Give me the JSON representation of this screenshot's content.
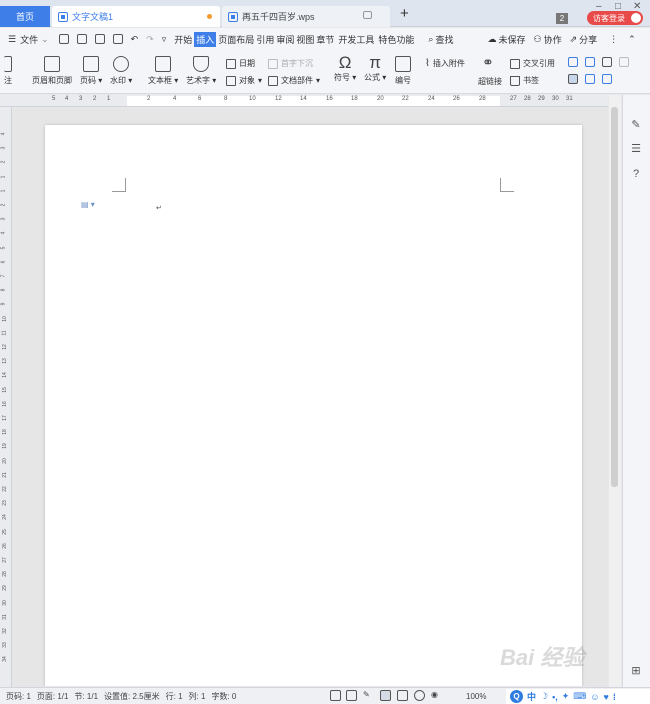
{
  "tabs": {
    "home": "首页",
    "active_doc": "文字文稿1",
    "other_doc": "再五千四百岁.wps",
    "badge": "2",
    "login": "访客登录"
  },
  "menu": {
    "file": "文件",
    "items": [
      "开始",
      "插入",
      "页面布局",
      "引用",
      "审阅",
      "视图",
      "章节",
      "开发工具",
      "特色功能"
    ],
    "active": "插入",
    "search": "查找",
    "unsaved": "未保存",
    "collab": "协作",
    "share": "分享"
  },
  "ribbon": {
    "note": "注",
    "header_footer": "页眉和页脚",
    "page_num": "页码",
    "watermark": "水印",
    "textbox": "文本框",
    "wordart": "艺术字",
    "date": "日期",
    "object": "对象",
    "dropcap": "首字下沉",
    "doc_parts": "文档部件",
    "symbol": "符号",
    "formula": "公式",
    "number": "编号",
    "attach": "插入附件",
    "hyperlink": "超链接",
    "crossref": "交叉引用",
    "bookmark": "书签"
  },
  "ruler": {
    "left": [
      "5",
      "4",
      "3",
      "2",
      "1"
    ],
    "marks": [
      "2",
      "4",
      "6",
      "8",
      "10",
      "12",
      "14",
      "16",
      "18",
      "20",
      "22",
      "24",
      "26",
      "28",
      "30"
    ],
    "right": [
      "27",
      "28",
      "29",
      "30",
      "31"
    ]
  },
  "status": {
    "page": "页码: 1",
    "pages": "页面: 1/1",
    "section": "节: 1/1",
    "setting": "设置值: 2.5厘米",
    "row": "行: 1",
    "col": "列: 1",
    "words": "字数: 0",
    "zoom": "100%"
  },
  "ime": {
    "lang": "中"
  },
  "watermark_text": "Bai 经验"
}
